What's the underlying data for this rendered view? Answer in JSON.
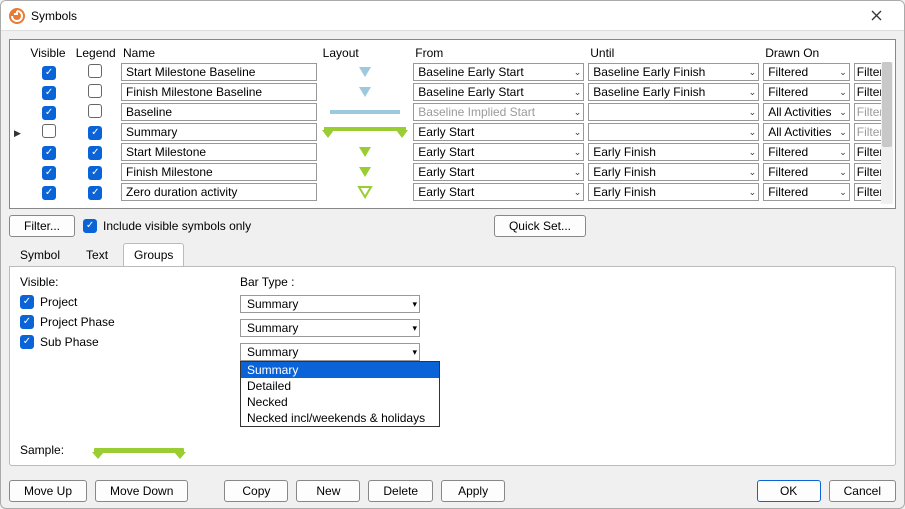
{
  "window": {
    "title": "Symbols",
    "close": "✕"
  },
  "headers": {
    "visible": "Visible",
    "legend": "Legend",
    "name": "Name",
    "layout": "Layout",
    "from": "From",
    "until": "Until",
    "drawn": "Drawn On"
  },
  "rows": [
    {
      "visible": true,
      "legend": false,
      "name": "Start Milestone Baseline",
      "shape": "tri-down-blue",
      "from": "Baseline Early Start",
      "fromDisabled": false,
      "until": "Baseline Early Finish",
      "drawn": "Filtered",
      "filter": "Filter...",
      "filterDisabled": false,
      "current": false
    },
    {
      "visible": true,
      "legend": false,
      "name": "Finish Milestone Baseline",
      "shape": "tri-down-blue",
      "from": "Baseline Early Start",
      "fromDisabled": false,
      "until": "Baseline Early Finish",
      "drawn": "Filtered",
      "filter": "Filter...",
      "filterDisabled": false,
      "current": false
    },
    {
      "visible": true,
      "legend": false,
      "name": "Baseline",
      "shape": "bar-blue",
      "from": "Baseline Implied Start",
      "fromDisabled": true,
      "until": "",
      "drawn": "All Activities",
      "filter": "Filter...",
      "filterDisabled": true,
      "current": false
    },
    {
      "visible": false,
      "legend": true,
      "name": "Summary",
      "shape": "summary-green",
      "from": "Early Start",
      "fromDisabled": false,
      "until": "",
      "drawn": "All Activities",
      "filter": "Filter...",
      "filterDisabled": true,
      "current": true
    },
    {
      "visible": true,
      "legend": true,
      "name": "Start Milestone",
      "shape": "tri-down-green",
      "from": "Early Start",
      "fromDisabled": false,
      "until": "Early Finish",
      "drawn": "Filtered",
      "filter": "Filter...",
      "filterDisabled": false,
      "current": false
    },
    {
      "visible": true,
      "legend": true,
      "name": "Finish Milestone",
      "shape": "tri-down-green",
      "from": "Early Start",
      "fromDisabled": false,
      "until": "Early Finish",
      "drawn": "Filtered",
      "filter": "Filter...",
      "filterDisabled": false,
      "current": false
    },
    {
      "visible": true,
      "legend": true,
      "name": "Zero duration activity",
      "shape": "tri-down-hollow",
      "from": "Early Start",
      "fromDisabled": false,
      "until": "Early Finish",
      "drawn": "Filtered",
      "filter": "Filter...",
      "filterDisabled": false,
      "current": false
    }
  ],
  "mid": {
    "filterBtn": "Filter...",
    "includeVisible": "Include visible symbols only",
    "quickSet": "Quick Set..."
  },
  "tabs": {
    "symbol": "Symbol",
    "text": "Text",
    "groups": "Groups"
  },
  "groups": {
    "visibleLabel": "Visible:",
    "barTypeLabel": "Bar Type :",
    "rows": [
      {
        "label": "Project",
        "checked": true,
        "barType": "Summary"
      },
      {
        "label": "Project Phase",
        "checked": true,
        "barType": "Summary"
      },
      {
        "label": "Sub Phase",
        "checked": true,
        "barType": "Summary"
      }
    ],
    "dropdownOptions": [
      "Summary",
      "Detailed",
      "Necked",
      "Necked incl/weekends & holidays"
    ],
    "sampleLabel": "Sample:"
  },
  "footer": {
    "moveUp": "Move Up",
    "moveDown": "Move Down",
    "copy": "Copy",
    "new": "New",
    "delete": "Delete",
    "apply": "Apply",
    "ok": "OK",
    "cancel": "Cancel"
  }
}
